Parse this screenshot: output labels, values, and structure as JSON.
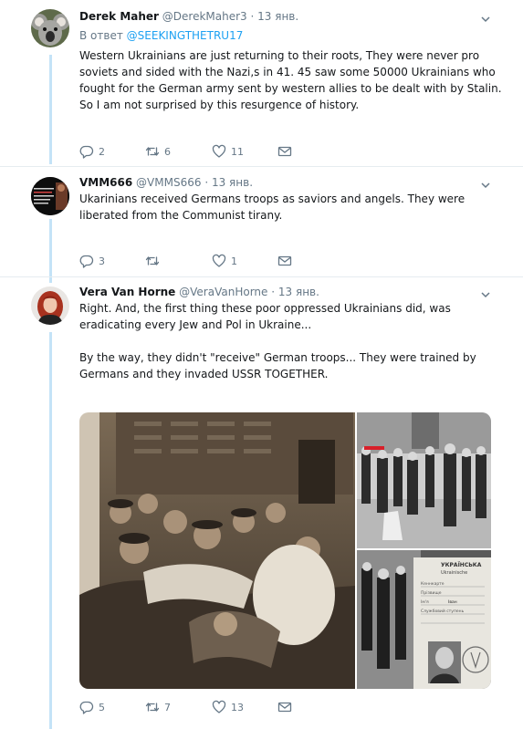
{
  "tweets": [
    {
      "name": "Derek Maher",
      "handle": "@DerekMaher3",
      "separator": "·",
      "date": "13 янв.",
      "reply_prefix": "В ответ",
      "reply_mention": "@SEEKINGTHETRU17",
      "lines": [
        "Western Ukrainians are just returning to their roots, They were never pro",
        "soviets and sided with the Nazi,s in 41. 45 saw some 50000 Ukrainians who",
        "fought for the German army sent by western allies to be dealt with by Stalin.",
        "So I am not surprised by this resurgence of history."
      ],
      "replies": "2",
      "retweets": "6",
      "likes": "11"
    },
    {
      "name": "VMM666",
      "handle": "@VMMS666",
      "separator": "·",
      "date": "13 янв.",
      "avatar_caption": "\"If you know the enemy and know yourself you need not fear the result of a hundred battles\"",
      "lines": [
        "Ukarinians received Germans troops as saviors and angels. They were",
        "liberated from the Communist tirany."
      ],
      "replies": "3",
      "retweets": "",
      "likes": "1"
    },
    {
      "name": "Vera Van Horne",
      "handle": "@VeraVanHorne",
      "separator": "·",
      "date": "13 янв.",
      "lines": [
        "Right. And, the first thing these poor oppressed Ukrainians did, was",
        "eradicating every Jew and Pol in Ukraine...",
        "By the way, they didn't \"receive\" German troops... They were trained by",
        "Germans and they invaded USSR TOGETHER."
      ],
      "replies": "5",
      "retweets": "7",
      "likes": "13",
      "document_text": [
        "УКРАЇНСЬКА",
        "Ukrainische",
        "Кеннкарте",
        "Прізвище",
        "Ім'я",
        "Іван",
        "Службовий ступень"
      ]
    }
  ],
  "icons": {
    "reply": "reply-icon",
    "retweet": "retweet-icon",
    "like": "heart-icon",
    "message": "direct-message-icon",
    "caret": "chevron-down-icon"
  },
  "colors": {
    "accent": "#1da1f2",
    "secondary_text": "#657786",
    "thread_line": "#c4e3f7"
  }
}
